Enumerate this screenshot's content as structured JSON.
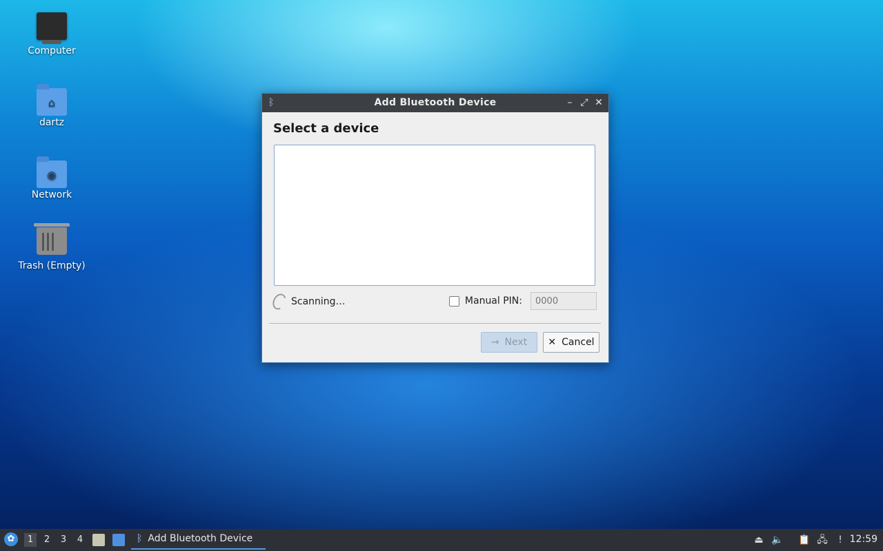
{
  "desktop": {
    "icons": [
      {
        "label": "Computer"
      },
      {
        "label": "dartz"
      },
      {
        "label": "Network"
      },
      {
        "label": "Trash (Empty)"
      }
    ]
  },
  "dialog": {
    "title": "Add Bluetooth Device",
    "heading": "Select a device",
    "status_text": "Scanning…",
    "manual_pin_label": "Manual PIN:",
    "manual_pin_checked": false,
    "pin_placeholder": "0000",
    "next_label": "Next",
    "next_enabled": false,
    "cancel_label": "Cancel"
  },
  "taskbar": {
    "workspaces": [
      "1",
      "2",
      "3",
      "4"
    ],
    "active_workspace": "1",
    "task_label": "Add Bluetooth Device",
    "clock": "12:59"
  },
  "colors": {
    "titlebar": "#3c3f44",
    "accent": "#5a9ae0",
    "taskbar": "#2d3137"
  }
}
